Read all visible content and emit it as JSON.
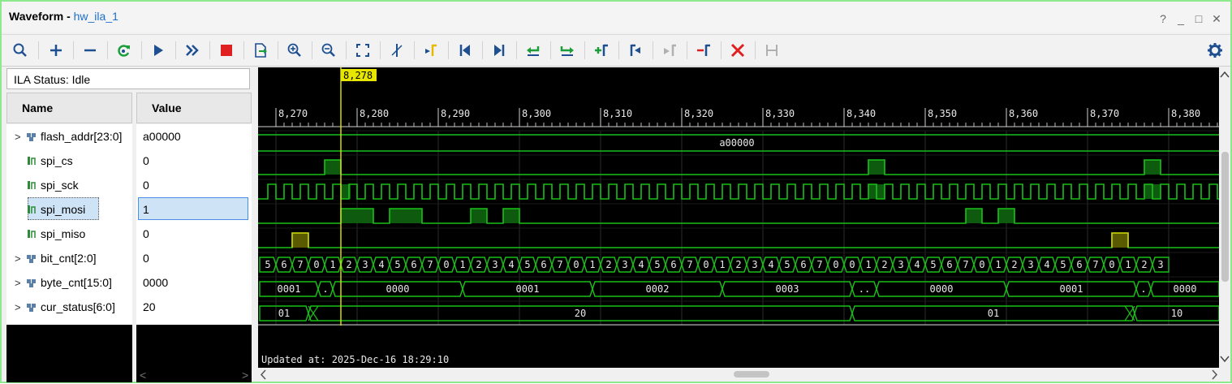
{
  "window": {
    "title": "Waveform",
    "separator": "-",
    "subtitle": "hw_ila_1",
    "controls": [
      "?",
      "_",
      "□",
      "✕"
    ]
  },
  "toolbar": {
    "icons": [
      "search-icon",
      "zoom-in-plus-icon",
      "zoom-out-minus-icon",
      "refresh-icon",
      "run-trigger-icon",
      "run-immediate-icon",
      "stop-icon",
      "export-icon",
      "zoom-in-icon",
      "zoom-out-icon",
      "zoom-fit-icon",
      "cursor-icon",
      "marker-icon",
      "go-to-start-icon",
      "go-to-end-icon",
      "previous-transition-icon",
      "next-transition-icon",
      "add-marker-icon",
      "previous-marker-icon",
      "next-marker-icon",
      "swap-cursors-icon",
      "delete-icon",
      "snap-icon",
      "settings-icon"
    ]
  },
  "ila_status": "ILA Status: Idle",
  "columns": {
    "name": "Name",
    "value": "Value"
  },
  "signals": [
    {
      "name": "flash_addr[23:0]",
      "value": "a00000",
      "expandable": true,
      "type": "bus"
    },
    {
      "name": "spi_cs",
      "value": "0",
      "expandable": false,
      "type": "bit"
    },
    {
      "name": "spi_sck",
      "value": "0",
      "expandable": false,
      "type": "bit"
    },
    {
      "name": "spi_mosi",
      "value": "1",
      "expandable": false,
      "type": "bit",
      "selected": true
    },
    {
      "name": "spi_miso",
      "value": "0",
      "expandable": false,
      "type": "bit"
    },
    {
      "name": "bit_cnt[2:0]",
      "value": "0",
      "expandable": true,
      "type": "bus"
    },
    {
      "name": "byte_cnt[15:0]",
      "value": "0000",
      "expandable": true,
      "type": "bus"
    },
    {
      "name": "cur_status[6:0]",
      "value": "20",
      "expandable": true,
      "type": "bus"
    }
  ],
  "timeline": {
    "cursor_label": "8,278",
    "tick_labels": [
      "8,270",
      "8,280",
      "8,290",
      "8,300",
      "8,310",
      "8,320",
      "8,330",
      "8,340",
      "8,350",
      "8,360",
      "8,370",
      "8,380"
    ]
  },
  "bus_values": {
    "flash_addr": "a00000",
    "bit_cnt_segments": [
      "5",
      "6",
      "7",
      "0",
      "1",
      "2",
      "3",
      "4",
      "5",
      "6",
      "7",
      "0",
      "1",
      "2",
      "3",
      "4",
      "5",
      "6",
      "7",
      "0",
      "1",
      "2",
      "3",
      "4",
      "5",
      "6",
      "7",
      "0",
      "1",
      "2",
      "3",
      "4",
      "5",
      "6",
      "7",
      "0",
      "0",
      "1",
      "2",
      "3",
      "4",
      "5",
      "6",
      "7",
      "0",
      "1",
      "2",
      "3",
      "4",
      "5",
      "6",
      "7",
      "0",
      "1",
      "2",
      "3"
    ],
    "byte_cnt_segments": [
      "0001",
      ".",
      "0000",
      "0001",
      "0002",
      "0003",
      "..",
      "0000",
      "0001",
      ".",
      "0000"
    ],
    "cur_status_segments": [
      "01",
      "20",
      "01",
      "10"
    ]
  },
  "updated_at": "Updated at: 2025-Dec-16 18:29:10",
  "colors": {
    "wave_green": "#18c018",
    "cursor_yellow": "#e6e600",
    "miso_fill": "#5a5a00",
    "grid": "#2b2b2b",
    "link_blue": "#1e6fcc",
    "stop_red": "#e02020"
  }
}
